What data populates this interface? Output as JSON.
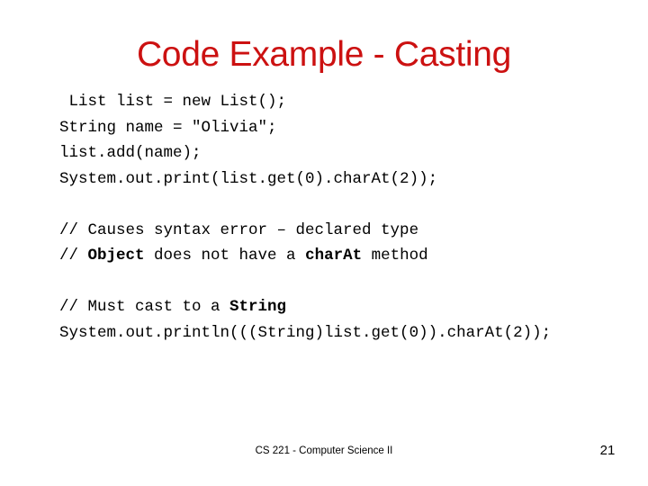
{
  "slide": {
    "title": "Code Example - Casting",
    "title_color": "#cc1111",
    "background_color": "#ffffff",
    "text_color": "#000000"
  },
  "code": {
    "lines": [
      {
        "id": "line-1",
        "segments": [
          {
            "text": " List list = new List();",
            "bold": false
          }
        ]
      },
      {
        "id": "line-2",
        "segments": [
          {
            "text": "String name = \"Olivia\";",
            "bold": false
          }
        ]
      },
      {
        "id": "line-3",
        "segments": [
          {
            "text": "list.add(name);",
            "bold": false
          }
        ]
      },
      {
        "id": "line-4",
        "segments": [
          {
            "text": "System.out.print(list.get(0).charAt(2));",
            "bold": false
          }
        ]
      },
      {
        "id": "line-5",
        "segments": []
      },
      {
        "id": "line-6",
        "segments": [
          {
            "text": "// Causes syntax error – declared type",
            "bold": false
          }
        ]
      },
      {
        "id": "line-7",
        "segments": [
          {
            "text": "// ",
            "bold": false
          },
          {
            "text": "Object",
            "bold": true
          },
          {
            "text": " does not have a ",
            "bold": false
          },
          {
            "text": "charAt",
            "bold": true
          },
          {
            "text": " method",
            "bold": false
          }
        ]
      },
      {
        "id": "line-8",
        "segments": []
      },
      {
        "id": "line-9",
        "segments": [
          {
            "text": "// Must cast to a ",
            "bold": false
          },
          {
            "text": "String",
            "bold": true
          }
        ]
      },
      {
        "id": "line-10",
        "segments": [
          {
            "text": "System.out.println(((String)list.get(0)).charAt(2));",
            "bold": false
          }
        ]
      }
    ]
  },
  "footer": {
    "course": "CS 221 - Computer Science II",
    "page_number": "21"
  }
}
